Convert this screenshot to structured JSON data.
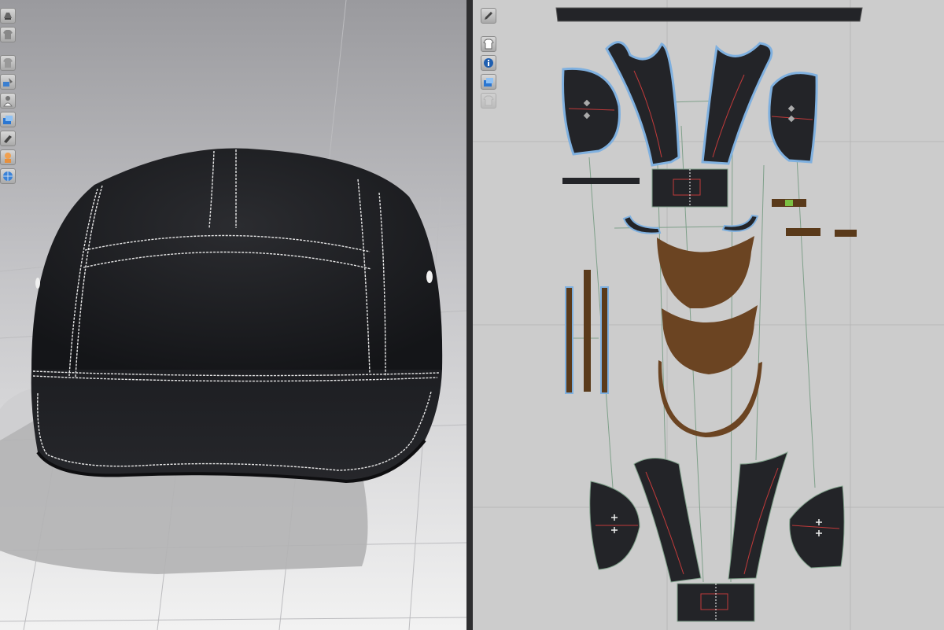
{
  "views": {
    "avatar_3d": {
      "label": ""
    },
    "pattern_2d": {
      "label": ""
    }
  },
  "toolbar_3d": [
    {
      "icon": "garment-display-icon"
    },
    {
      "icon": "shirt-icon"
    },
    {
      "icon": "avatar-display-icon"
    },
    {
      "icon": "texture-icon"
    },
    {
      "icon": "avatar-pose-icon"
    },
    {
      "icon": "fabric-view-icon"
    },
    {
      "icon": "camera-icon"
    },
    {
      "icon": "skin-icon"
    },
    {
      "icon": "globe-icon"
    }
  ],
  "toolbar_2d": [
    {
      "icon": "pencil-icon"
    },
    {
      "icon": "shirt-icon"
    },
    {
      "icon": "info-icon"
    },
    {
      "icon": "fabric-view-icon"
    },
    {
      "icon": "garment-disabled-icon"
    }
  ],
  "colors": {
    "fabric_dark": "#232428",
    "visor_brown": "#6b4422",
    "stitch_white": "#e8e8e8",
    "selection_blue": "#7fb0df",
    "seam_red": "#c23a3a",
    "grid": "#b5b5b5"
  }
}
